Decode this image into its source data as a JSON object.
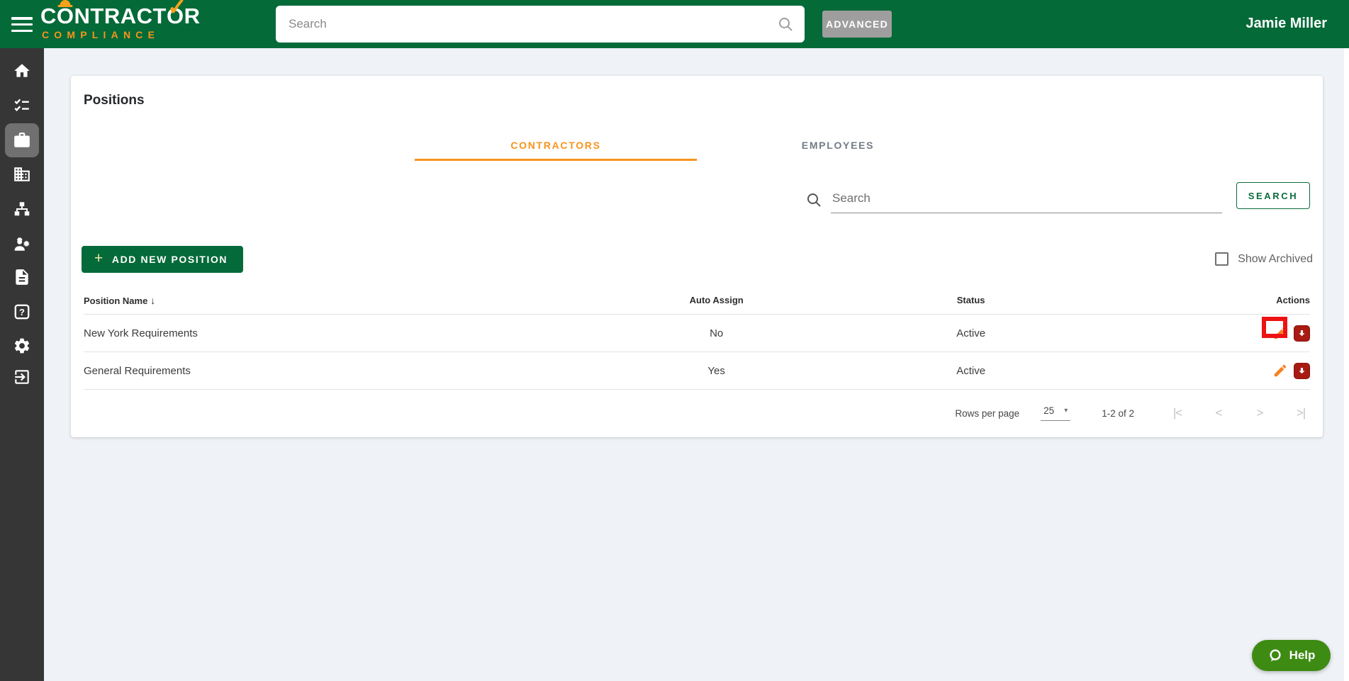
{
  "colors": {
    "header_green": "#046a38",
    "brand_orange": "#f7941d",
    "sidebar_gray": "#363636",
    "button_green": "#056a39",
    "help_green": "#3e8b13",
    "edit_orange": "#f5821f",
    "archive_red": "#a81a12",
    "annotation_red": "#ee1212"
  },
  "header": {
    "logo": {
      "part1": "C",
      "o1": "O",
      "part2": "NTRACT",
      "o2": "O",
      "part3": "R",
      "check_glyph": "✓",
      "line2": "COMPLIANCE"
    },
    "search_placeholder": "Search",
    "advanced_label": "ADVANCED",
    "user_name": "Jamie Miller"
  },
  "sidebar": {
    "icons": [
      "home",
      "tasks",
      "positions",
      "company",
      "org-chart",
      "workers",
      "documents",
      "help",
      "settings",
      "logout"
    ],
    "selected": "positions"
  },
  "page": {
    "title": "Positions"
  },
  "tabs": {
    "contractors": "CONTRACTORS",
    "employees": "EMPLOYEES",
    "active": "CONTRACTORS"
  },
  "filter": {
    "search_placeholder": "Search",
    "search_button_label": "SEARCH"
  },
  "toolbar": {
    "add_icon": "+",
    "add_label": "ADD NEW POSITION",
    "show_archived_label": "Show Archived",
    "show_archived_checked": false
  },
  "table": {
    "headers": {
      "name": "Position Name",
      "auto_assign": "Auto Assign",
      "status": "Status",
      "actions": "Actions"
    },
    "sort_icon": "↓",
    "rows": [
      {
        "name": "New York Requirements",
        "auto_assign": "No",
        "status": "Active",
        "highlighted": true
      },
      {
        "name": "General Requirements",
        "auto_assign": "Yes",
        "status": "Active",
        "highlighted": false
      }
    ]
  },
  "pagination": {
    "rows_per_page_label": "Rows per page",
    "rows_per_page_value": "25",
    "caret": "▾",
    "range": "1-2 of 2",
    "first_icon": "|<",
    "prev_icon": "<",
    "next_icon": ">",
    "last_icon": ">|"
  },
  "help": {
    "label": "Help"
  }
}
